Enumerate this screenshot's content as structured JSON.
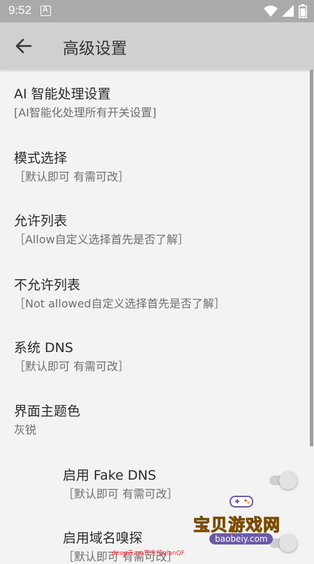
{
  "status_bar": {
    "time": "9:52"
  },
  "app_bar": {
    "title": "高级设置"
  },
  "items": [
    {
      "title": "AI 智能处理设置",
      "subtitle": "[AI智能化处理所有开关设置]"
    },
    {
      "title": "模式选择",
      "subtitle": "［默认即可 有需可改］"
    },
    {
      "title": "允许列表",
      "subtitle": "［Allow自定义选择首先是否了解］"
    },
    {
      "title": "不允许列表",
      "subtitle": "［Not allowed自定义选择首先是否了解］"
    },
    {
      "title": "系统 DNS",
      "subtitle": "［默认即可 有需可改］"
    },
    {
      "title": "界面主题色",
      "subtitle": "灰锐"
    }
  ],
  "toggle_items": [
    {
      "title": "启用 Fake DNS",
      "subtitle": "［默认即可 有需可改］",
      "enabled": false
    },
    {
      "title": "启用域名嗅探",
      "subtitle": "［默认即可 有需可改］",
      "enabled": false
    }
  ],
  "watermark": {
    "title": "宝贝游戏网",
    "url": "baobeiy.com"
  },
  "overlay_text": "deep去-go官方技qianQF",
  "colors": {
    "status_bar": "#aaaaaa",
    "app_bar": "#d0d0d0",
    "background": "#f3f3f3"
  }
}
